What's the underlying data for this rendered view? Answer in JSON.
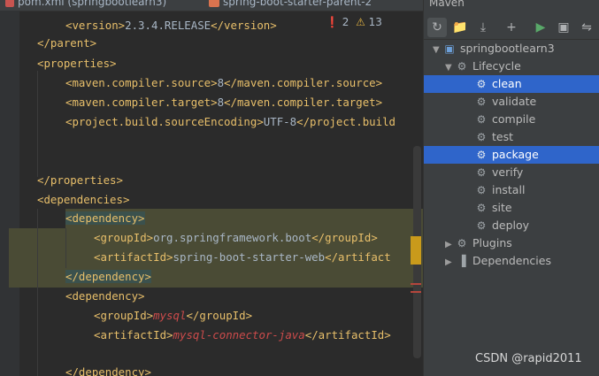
{
  "tabs": [
    {
      "label": "pom.xml (springbootlearn3)"
    },
    {
      "label": "spring-boot-starter-parent-2"
    }
  ],
  "inspections": {
    "errors": "2",
    "warnings": "13"
  },
  "code": {
    "l1": {
      "open": "<version>",
      "text": "2.3.4.RELEASE",
      "close": "</version>"
    },
    "l2": "</parent>",
    "l3": "<properties>",
    "l4": {
      "open": "<maven.compiler.source>",
      "text": "8",
      "close": "</maven.compiler.source>"
    },
    "l5": {
      "open": "<maven.compiler.target>",
      "text": "8",
      "close": "</maven.compiler.target>"
    },
    "l6": {
      "open": "<project.build.sourceEncoding>",
      "text": "UTF-8",
      "close": "</project.build"
    },
    "l9": "</properties>",
    "l10": "<dependencies>",
    "l11": "<dependency>",
    "l12": {
      "open": "<groupId>",
      "text": "org.springframework.boot",
      "close": "</groupId>"
    },
    "l13": {
      "open": "<artifactId>",
      "text": "spring-boot-starter-web",
      "close": "</artifact"
    },
    "l14": "</dependency>",
    "l15": "<dependency>",
    "l16": {
      "open": "<groupId>",
      "text": "mysql",
      "close": "</groupId>"
    },
    "l17": {
      "open": "<artifactId>",
      "text": "mysql-connector-java",
      "close": "</artifactId>"
    },
    "l19": "</dependency>"
  },
  "maven": {
    "title": "Maven",
    "toolbar": [
      "refresh-icon",
      "add-folder-icon",
      "download-icon",
      "plus-icon",
      "run-icon",
      "console-icon",
      "toggle-offline-icon"
    ],
    "project": "springbootlearn3",
    "lifecycle": "Lifecycle",
    "goals": [
      "clean",
      "validate",
      "compile",
      "test",
      "package",
      "verify",
      "install",
      "site",
      "deploy"
    ],
    "plugins": "Plugins",
    "dependencies": "Dependencies",
    "selected": [
      "clean",
      "package"
    ],
    "selection_color": "#2f65ca"
  },
  "watermark": "CSDN @rapid2011"
}
